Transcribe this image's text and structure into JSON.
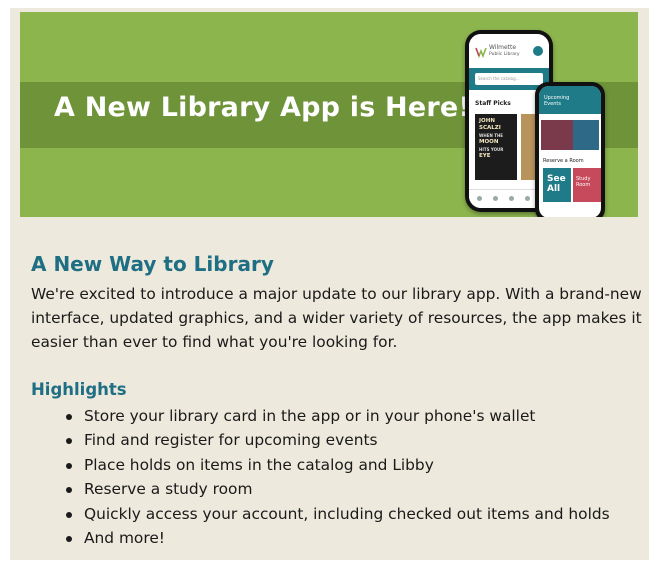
{
  "banner": {
    "title": "A New Library App is Here!",
    "colors": {
      "banner": "#8db54e",
      "stripe": "#6f9338",
      "accent": "#1e7b87"
    },
    "phone_main": {
      "library_name_line1": "Wilmette",
      "library_name_line2": "Public Library",
      "search_placeholder": "Search the catalog...",
      "section_label": "Staff Picks",
      "book_cover_text": [
        "JOHN",
        "SCALZI",
        "WHEN THE",
        "MOON",
        "HITS YOUR",
        "EYE"
      ]
    },
    "phone_second": {
      "header_line1": "Upcoming",
      "header_line2": "Events",
      "section_label": "Reserve a Room",
      "tile_see_all": "See All",
      "tile_room": "Study Room"
    }
  },
  "content": {
    "heading": "A New Way to Library",
    "intro": "We're excited to introduce a major update to our library app. With a brand-new interface, updated graphics, and a wider variety of resources, the app makes it easier than ever to find what you're looking for.",
    "highlights_heading": "Highlights",
    "highlights": [
      "Store your library card in the app or in your phone's wallet",
      "Find and register for upcoming events",
      "Place holds on items in the catalog and Libby",
      "Reserve a study room",
      "Quickly access your account, including checked out items and holds",
      "And more!"
    ]
  }
}
